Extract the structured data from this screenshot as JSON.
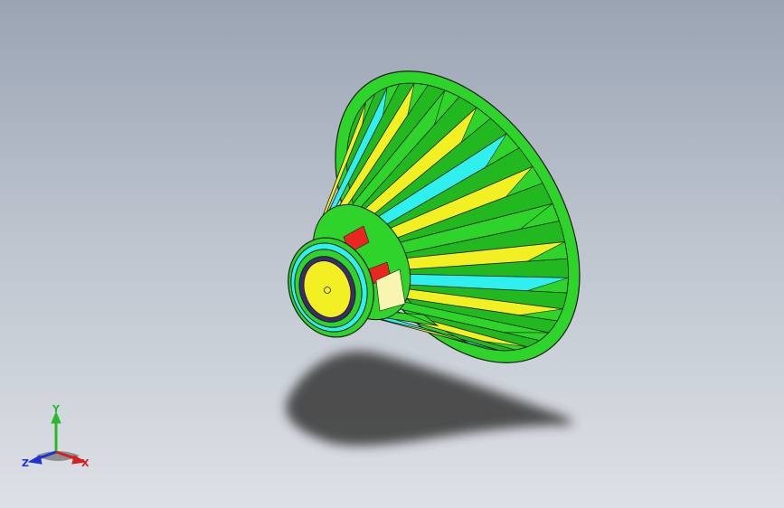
{
  "viewport": {
    "colors": {
      "background_top": "#9aa4b3",
      "background_bottom": "#dde1e6",
      "shadow": "#3b3b3b",
      "blade_green": "#2fd42a",
      "blade_yellow": "#f2f023",
      "blade_cyan": "#2ff0ee",
      "hub_red": "#e8281e",
      "outline": "#1b1b1b"
    },
    "model": {
      "name": "turbine-runner",
      "blade_count": 17
    }
  },
  "triad": {
    "x_label": "X",
    "y_label": "Y",
    "z_label": "Z",
    "x_color": "#d42020",
    "y_color": "#2cb82c",
    "z_color": "#2030d4"
  }
}
